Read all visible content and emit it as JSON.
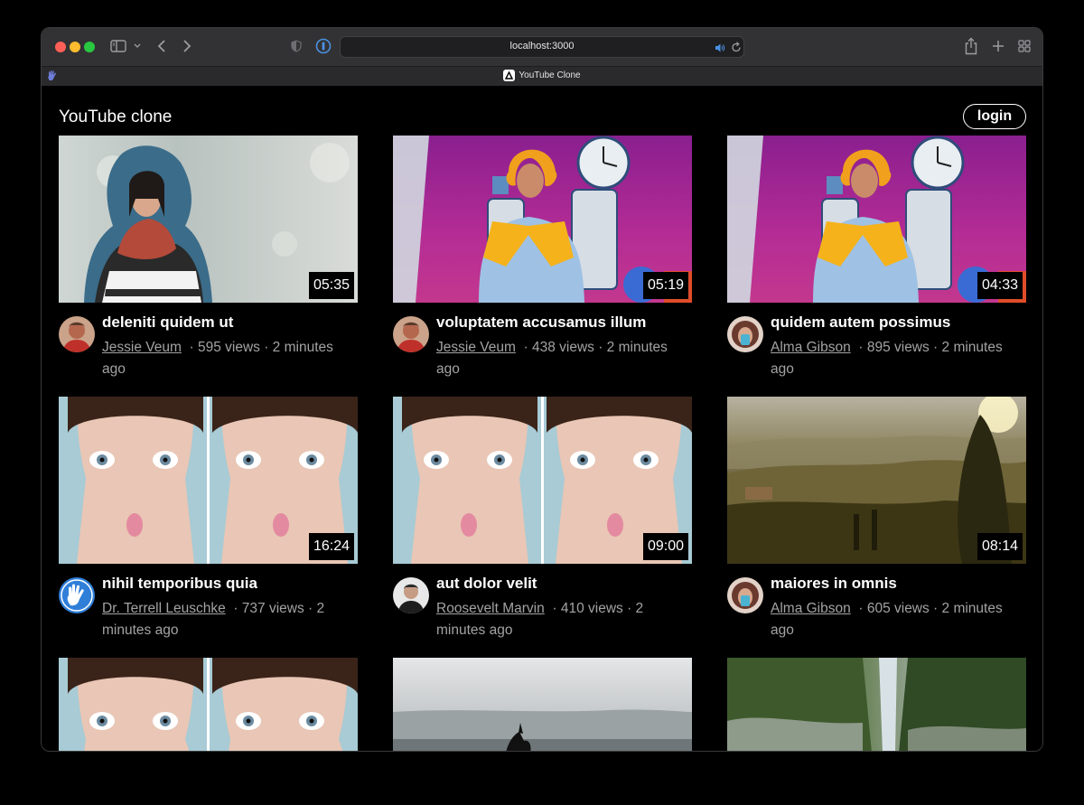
{
  "browser": {
    "url": "localhost:3000",
    "tab_title": "YouTube Clone"
  },
  "site": {
    "title": "YouTube clone",
    "login_label": "login"
  },
  "videos": [
    {
      "title": "deleniti quidem ut",
      "channel": "Jessie Veum",
      "stats": "· 595 views · 2 minutes ago",
      "duration": "05:35",
      "thumbnail": "woman-in-scarf"
    },
    {
      "title": "voluptatem accusamus illum",
      "channel": "Jessie Veum",
      "stats": "· 438 views · 2 minutes ago",
      "duration": "05:19",
      "thumbnail": "man-in-costume-on-stage"
    },
    {
      "title": "quidem autem possimus",
      "channel": "Alma Gibson",
      "stats": "· 895 views · 2 minutes ago",
      "duration": "04:33",
      "thumbnail": "man-in-costume-on-stage"
    },
    {
      "title": "nihil temporibus quia",
      "channel": "Dr. Terrell Leuschke",
      "stats": "· 737 views · 2 minutes ago",
      "duration": "16:24",
      "thumbnail": "woman-fish-face"
    },
    {
      "title": "aut dolor velit",
      "channel": "Roosevelt Marvin",
      "stats": "· 410 views · 2 minutes ago",
      "duration": "09:00",
      "thumbnail": "woman-fish-face"
    },
    {
      "title": "maiores in omnis",
      "channel": "Alma Gibson",
      "stats": "· 605 views · 2 minutes ago",
      "duration": "08:14",
      "thumbnail": "tuscan-landscape"
    },
    {
      "title": "",
      "channel": "",
      "stats": "",
      "duration": "",
      "thumbnail": "woman-fish-face"
    },
    {
      "title": "",
      "channel": "",
      "stats": "",
      "duration": "",
      "thumbnail": "orca-sea"
    },
    {
      "title": "",
      "channel": "",
      "stats": "",
      "duration": "",
      "thumbnail": "waterfall-canyon"
    }
  ],
  "colors": {
    "background": "#000000",
    "toolbar": "#323234",
    "meta_text": "#a3a3a3"
  }
}
